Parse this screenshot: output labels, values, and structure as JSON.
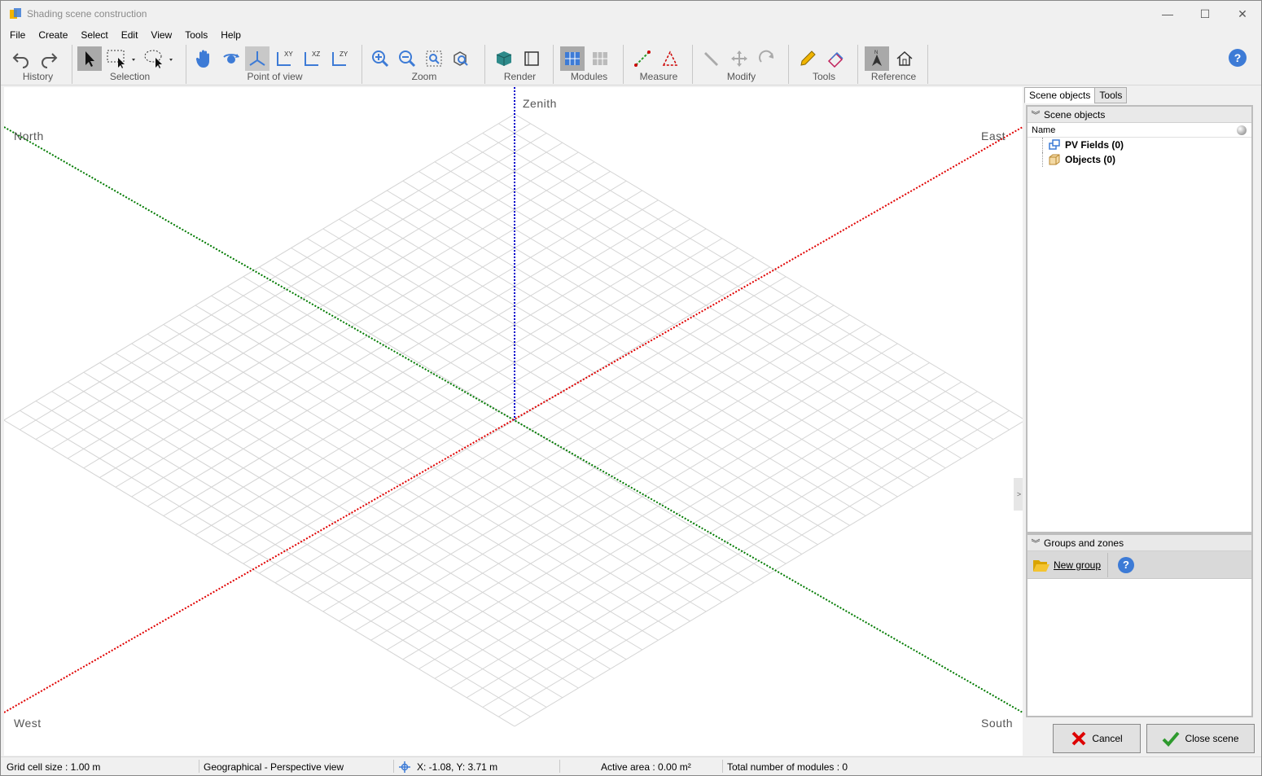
{
  "window": {
    "title": "Shading scene construction",
    "controls": {
      "minimize": "—",
      "maximize": "☐",
      "close": "✕"
    }
  },
  "menu": [
    "File",
    "Create",
    "Select",
    "Edit",
    "View",
    "Tools",
    "Help"
  ],
  "toolbar": {
    "groups": {
      "history": "History",
      "selection": "Selection",
      "point_of_view": "Point of view",
      "zoom": "Zoom",
      "render": "Render",
      "modules": "Modules",
      "measure": "Measure",
      "modify": "Modify",
      "tools": "Tools",
      "reference": "Reference"
    },
    "help": "?"
  },
  "viewport": {
    "labels": {
      "zenith": "Zenith",
      "north": "North",
      "east": "East",
      "west": "West",
      "south": "South"
    },
    "collapse_glyph": ">",
    "colors": {
      "north_south_axis": "#007a00",
      "east_west_axis": "#e00000",
      "vertical_axis": "#0000cc",
      "grid": "#d4d4d4"
    }
  },
  "right_panel": {
    "tabs": [
      "Scene objects",
      "Tools"
    ],
    "scene_objects": {
      "header": "Scene objects",
      "column_name": "Name",
      "items": [
        "PV Fields (0)",
        "Objects (0)"
      ]
    },
    "groups_zones": {
      "header": "Groups and zones",
      "new_group": "New group",
      "help": "?"
    },
    "cancel": "Cancel",
    "close_scene": "Close scene"
  },
  "status": {
    "grid_cell": "Grid cell size :  1.00 m",
    "view_mode": "Geographical - Perspective view",
    "coords": "X: -1.08, Y: 3.71 m",
    "active_area": "Active area : 0.00 m²",
    "total_modules": "Total number of modules : 0"
  }
}
